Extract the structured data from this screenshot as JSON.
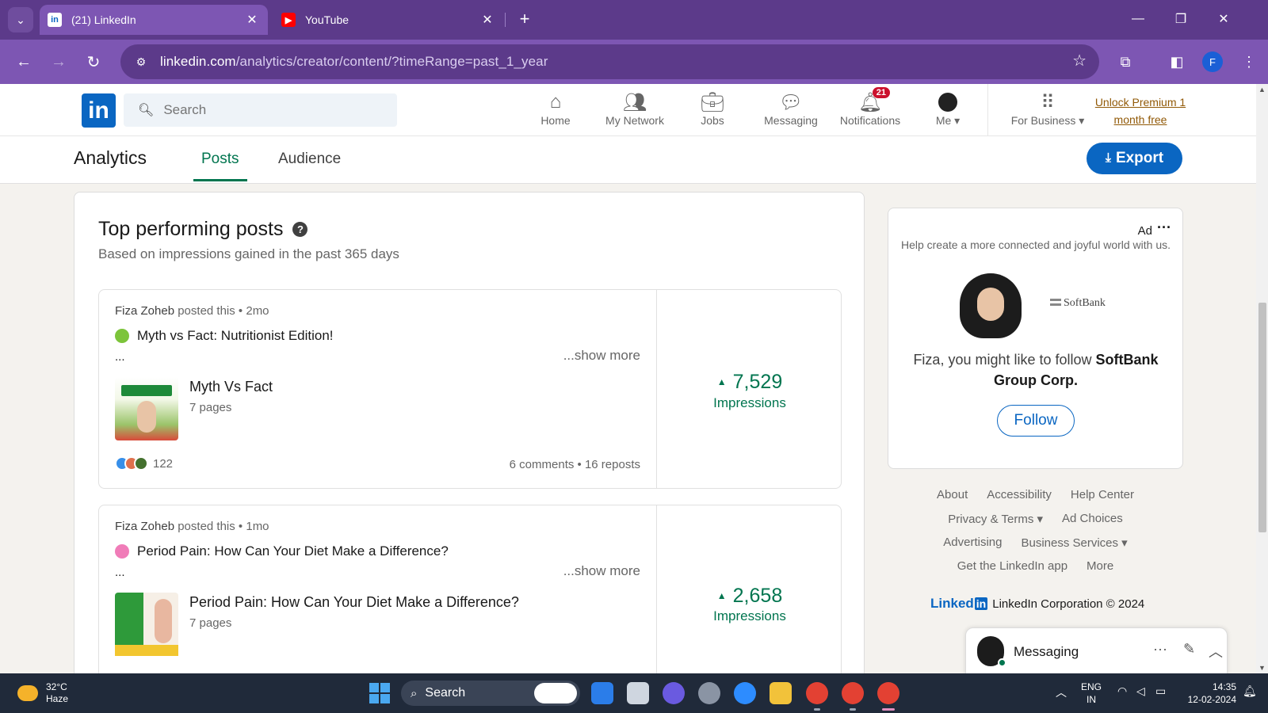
{
  "browser": {
    "tabs": [
      {
        "title": "(21) LinkedIn",
        "favicon": "linkedin-icon",
        "active": true
      },
      {
        "title": "YouTube",
        "favicon": "youtube-icon",
        "active": false
      }
    ],
    "url_host": "linkedin.com",
    "url_path": "/analytics/creator/content/?timeRange=past_1_year",
    "profile_initial": "F",
    "colors": {
      "frame": "#5c3a8a",
      "toolbar": "#7d56b3"
    }
  },
  "header": {
    "search_placeholder": "Search",
    "nav": [
      {
        "label": "Home",
        "icon": "home-icon"
      },
      {
        "label": "My Network",
        "icon": "network-icon"
      },
      {
        "label": "Jobs",
        "icon": "briefcase-icon"
      },
      {
        "label": "Messaging",
        "icon": "chat-icon"
      },
      {
        "label": "Notifications",
        "icon": "bell-icon",
        "badge": "21"
      },
      {
        "label": "Me",
        "icon": "avatar"
      },
      {
        "label": "For Business",
        "icon": "grid-icon"
      }
    ],
    "premium_line1": "Unlock Premium 1",
    "premium_line2": "month free",
    "brand_color": "#0a66c2"
  },
  "subnav": {
    "title": "Analytics",
    "tabs": [
      "Posts",
      "Audience"
    ],
    "active_tab": "Posts",
    "export_label": "Export"
  },
  "main": {
    "title": "Top performing posts",
    "subtitle": "Based on impressions gained in the past 365 days",
    "posts": [
      {
        "author": "Fiza Zoheb",
        "meta": " posted this • 2mo",
        "headline": "Myth vs Fact: Nutritionist Edition!",
        "ellipsis": "...",
        "show_more": "...show more",
        "doc_title": "Myth Vs Fact",
        "doc_pages": "7 pages",
        "reactions": "122",
        "stats": "6 comments • 16 reposts",
        "impressions": "7,529",
        "impressions_label": "Impressions"
      },
      {
        "author": "Fiza Zoheb",
        "meta": " posted this • 1mo",
        "headline": "Period Pain: How Can Your Diet Make a Difference?",
        "ellipsis": "...",
        "show_more": "...show more",
        "doc_title": "Period Pain: How Can Your Diet Make a Difference?",
        "doc_pages": "7 pages",
        "impressions": "2,658",
        "impressions_label": "Impressions"
      }
    ]
  },
  "ad": {
    "label": "Ad",
    "description": "Help create a more connected and joyful world with us.",
    "company_logo": "SoftBank",
    "follow_prefix": "Fiza, you might like to follow ",
    "company": "SoftBank Group Corp.",
    "follow_label": "Follow"
  },
  "footer": {
    "rows": [
      [
        "About",
        "Accessibility",
        "Help Center"
      ],
      [
        "Privacy & Terms ▾",
        "Ad Choices"
      ],
      [
        "Advertising",
        "Business Services ▾"
      ],
      [
        "Get the LinkedIn app",
        "More"
      ]
    ],
    "brand": "Linked",
    "brand_in": "in",
    "copyright": "LinkedIn Corporation © 2024"
  },
  "messaging": {
    "label": "Messaging"
  },
  "taskbar": {
    "temp": "32°C",
    "weather": "Haze",
    "search": "Search",
    "lang1": "ENG",
    "lang2": "IN",
    "time": "14:35",
    "date": "12-02-2024"
  }
}
